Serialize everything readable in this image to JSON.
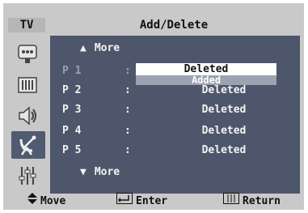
{
  "header": {
    "tv_label": "TV",
    "title": "Add/Delete"
  },
  "sidebar": {
    "icons": [
      "picture-icon",
      "sound-icon",
      "speaker-icon",
      "channel-antenna-icon",
      "setup-sliders-icon"
    ],
    "selected": "channel-antenna-icon"
  },
  "menu": {
    "more_up": "More",
    "more_down": "More",
    "rows": [
      {
        "program": "P 1",
        "colon": ":",
        "status": "Deleted",
        "dimmed": true
      },
      {
        "program": "P 2",
        "colon": ":",
        "status": "Deleted"
      },
      {
        "program": "P 3",
        "colon": ":",
        "status": "Deleted"
      },
      {
        "program": "P 4",
        "colon": ":",
        "status": "Deleted"
      },
      {
        "program": "P 5",
        "colon": ":",
        "status": "Deleted"
      }
    ],
    "dropdown": {
      "selected": "Deleted",
      "option": "Added"
    }
  },
  "footer": {
    "move": "Move",
    "enter": "Enter",
    "return": "Return"
  },
  "colors": {
    "panel": "#4d566b",
    "frame": "#c9c9c9",
    "text": "#f3f3f3"
  }
}
